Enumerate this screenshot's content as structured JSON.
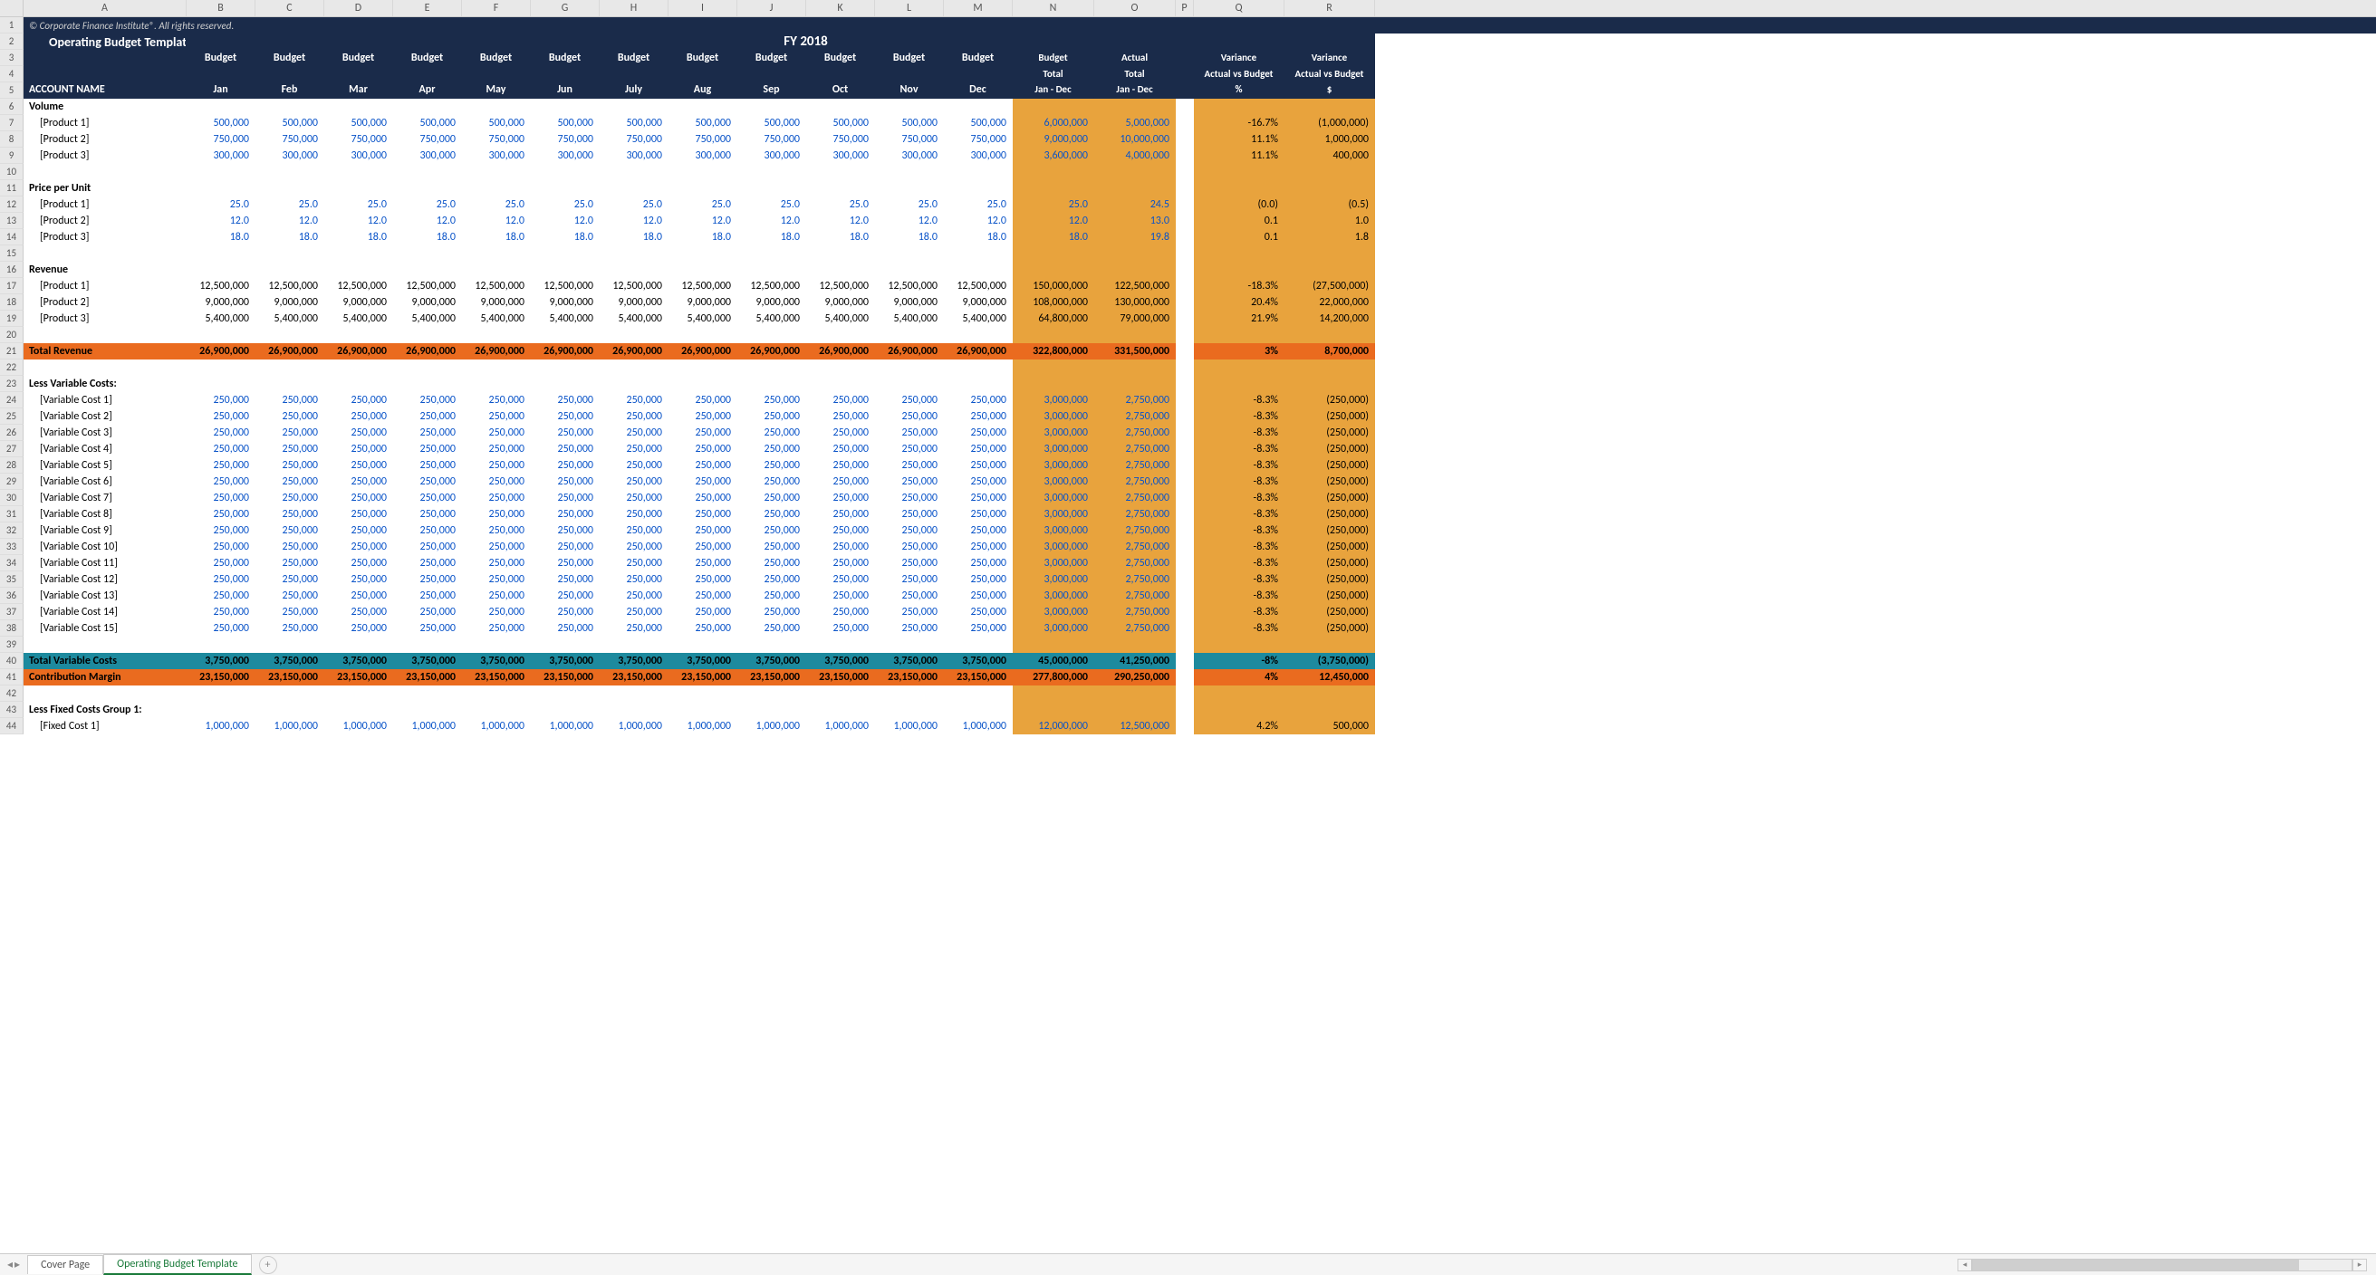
{
  "columns": [
    "A",
    "B",
    "C",
    "D",
    "E",
    "F",
    "G",
    "H",
    "I",
    "J",
    "K",
    "L",
    "M",
    "N",
    "O",
    "P",
    "Q",
    "R"
  ],
  "copyright": "© Corporate Finance Institute®. All rights reserved.",
  "title": "Operating Budget Template",
  "fy": "FY 2018",
  "header_budget": "Budget",
  "header_budget_total": "Budget Total",
  "header_actual_total": "Actual Total",
  "header_jan_dec": "Jan - Dec",
  "header_variance": "Variance",
  "header_avsb": "Actual vs Budget",
  "header_pct": "%",
  "header_dollar": "$",
  "header_account": "ACCOUNT NAME",
  "months": [
    "Jan",
    "Feb",
    "Mar",
    "Apr",
    "May",
    "Jun",
    "July",
    "Aug",
    "Sep",
    "Oct",
    "Nov",
    "Dec"
  ],
  "sections": {
    "volume": {
      "label": "Volume",
      "rows": [
        {
          "num": 7,
          "label": "[Product 1]",
          "vals": [
            "500,000",
            "500,000",
            "500,000",
            "500,000",
            "500,000",
            "500,000",
            "500,000",
            "500,000",
            "500,000",
            "500,000",
            "500,000",
            "500,000"
          ],
          "bt": "6,000,000",
          "at": "5,000,000",
          "vp": "-16.7%",
          "vd": "(1,000,000)"
        },
        {
          "num": 8,
          "label": "[Product 2]",
          "vals": [
            "750,000",
            "750,000",
            "750,000",
            "750,000",
            "750,000",
            "750,000",
            "750,000",
            "750,000",
            "750,000",
            "750,000",
            "750,000",
            "750,000"
          ],
          "bt": "9,000,000",
          "at": "10,000,000",
          "vp": "11.1%",
          "vd": "1,000,000"
        },
        {
          "num": 9,
          "label": "[Product 3]",
          "vals": [
            "300,000",
            "300,000",
            "300,000",
            "300,000",
            "300,000",
            "300,000",
            "300,000",
            "300,000",
            "300,000",
            "300,000",
            "300,000",
            "300,000"
          ],
          "bt": "3,600,000",
          "at": "4,000,000",
          "vp": "11.1%",
          "vd": "400,000"
        }
      ]
    },
    "ppu": {
      "label": "Price per Unit",
      "rows": [
        {
          "num": 12,
          "label": "[Product 1]",
          "vals": [
            "25.0",
            "25.0",
            "25.0",
            "25.0",
            "25.0",
            "25.0",
            "25.0",
            "25.0",
            "25.0",
            "25.0",
            "25.0",
            "25.0"
          ],
          "bt": "25.0",
          "at": "24.5",
          "vp": "(0.0)",
          "vd": "(0.5)"
        },
        {
          "num": 13,
          "label": "[Product 2]",
          "vals": [
            "12.0",
            "12.0",
            "12.0",
            "12.0",
            "12.0",
            "12.0",
            "12.0",
            "12.0",
            "12.0",
            "12.0",
            "12.0",
            "12.0"
          ],
          "bt": "12.0",
          "at": "13.0",
          "vp": "0.1",
          "vd": "1.0"
        },
        {
          "num": 14,
          "label": "[Product 3]",
          "vals": [
            "18.0",
            "18.0",
            "18.0",
            "18.0",
            "18.0",
            "18.0",
            "18.0",
            "18.0",
            "18.0",
            "18.0",
            "18.0",
            "18.0"
          ],
          "bt": "18.0",
          "at": "19.8",
          "vp": "0.1",
          "vd": "1.8"
        }
      ]
    },
    "revenue": {
      "label": "Revenue",
      "rows": [
        {
          "num": 17,
          "label": "[Product 1]",
          "vals": [
            "12,500,000",
            "12,500,000",
            "12,500,000",
            "12,500,000",
            "12,500,000",
            "12,500,000",
            "12,500,000",
            "12,500,000",
            "12,500,000",
            "12,500,000",
            "12,500,000",
            "12,500,000"
          ],
          "bt": "150,000,000",
          "at": "122,500,000",
          "vp": "-18.3%",
          "vd": "(27,500,000)"
        },
        {
          "num": 18,
          "label": "[Product 2]",
          "vals": [
            "9,000,000",
            "9,000,000",
            "9,000,000",
            "9,000,000",
            "9,000,000",
            "9,000,000",
            "9,000,000",
            "9,000,000",
            "9,000,000",
            "9,000,000",
            "9,000,000",
            "9,000,000"
          ],
          "bt": "108,000,000",
          "at": "130,000,000",
          "vp": "20.4%",
          "vd": "22,000,000"
        },
        {
          "num": 19,
          "label": "[Product 3]",
          "vals": [
            "5,400,000",
            "5,400,000",
            "5,400,000",
            "5,400,000",
            "5,400,000",
            "5,400,000",
            "5,400,000",
            "5,400,000",
            "5,400,000",
            "5,400,000",
            "5,400,000",
            "5,400,000"
          ],
          "bt": "64,800,000",
          "at": "79,000,000",
          "vp": "21.9%",
          "vd": "14,200,000"
        }
      ]
    },
    "total_revenue": {
      "num": 21,
      "label": "Total Revenue",
      "vals": [
        "26,900,000",
        "26,900,000",
        "26,900,000",
        "26,900,000",
        "26,900,000",
        "26,900,000",
        "26,900,000",
        "26,900,000",
        "26,900,000",
        "26,900,000",
        "26,900,000",
        "26,900,000"
      ],
      "bt": "322,800,000",
      "at": "331,500,000",
      "vp": "3%",
      "vd": "8,700,000"
    },
    "lvc_label": "Less Variable Costs:",
    "varcosts": [
      {
        "num": 24,
        "label": "[Variable Cost 1]"
      },
      {
        "num": 25,
        "label": "[Variable Cost 2]"
      },
      {
        "num": 26,
        "label": "[Variable Cost 3]"
      },
      {
        "num": 27,
        "label": "[Variable Cost 4]"
      },
      {
        "num": 28,
        "label": "[Variable Cost 5]"
      },
      {
        "num": 29,
        "label": "[Variable Cost 6]"
      },
      {
        "num": 30,
        "label": "[Variable Cost 7]"
      },
      {
        "num": 31,
        "label": "[Variable Cost 8]"
      },
      {
        "num": 32,
        "label": "[Variable Cost 9]"
      },
      {
        "num": 33,
        "label": "[Variable Cost 10]"
      },
      {
        "num": 34,
        "label": "[Variable Cost 11]"
      },
      {
        "num": 35,
        "label": "[Variable Cost 12]"
      },
      {
        "num": 36,
        "label": "[Variable Cost 13]"
      },
      {
        "num": 37,
        "label": "[Variable Cost 14]"
      },
      {
        "num": 38,
        "label": "[Variable Cost 15]"
      }
    ],
    "varcost_vals": {
      "m": "250,000",
      "bt": "3,000,000",
      "at": "2,750,000",
      "vp": "-8.3%",
      "vd": "(250,000)"
    },
    "tvc": {
      "num": 40,
      "label": "Total Variable Costs",
      "vals": [
        "3,750,000",
        "3,750,000",
        "3,750,000",
        "3,750,000",
        "3,750,000",
        "3,750,000",
        "3,750,000",
        "3,750,000",
        "3,750,000",
        "3,750,000",
        "3,750,000",
        "3,750,000"
      ],
      "bt": "45,000,000",
      "at": "41,250,000",
      "vp": "-8%",
      "vd": "(3,750,000)"
    },
    "cm": {
      "num": 41,
      "label": "Contribution Margin",
      "vals": [
        "23,150,000",
        "23,150,000",
        "23,150,000",
        "23,150,000",
        "23,150,000",
        "23,150,000",
        "23,150,000",
        "23,150,000",
        "23,150,000",
        "23,150,000",
        "23,150,000",
        "23,150,000"
      ],
      "bt": "277,800,000",
      "at": "290,250,000",
      "vp": "4%",
      "vd": "12,450,000"
    },
    "lfc_label": "Less Fixed Costs Group 1:",
    "fc1": {
      "num": 44,
      "label": "[Fixed Cost 1]",
      "vals": [
        "1,000,000",
        "1,000,000",
        "1,000,000",
        "1,000,000",
        "1,000,000",
        "1,000,000",
        "1,000,000",
        "1,000,000",
        "1,000,000",
        "1,000,000",
        "1,000,000",
        "1,000,000"
      ],
      "bt": "12,000,000",
      "at": "12,500,000",
      "vp": "4.2%",
      "vd": "500,000"
    }
  },
  "tabs": {
    "cover": "Cover Page",
    "active": "Operating Budget Template"
  }
}
